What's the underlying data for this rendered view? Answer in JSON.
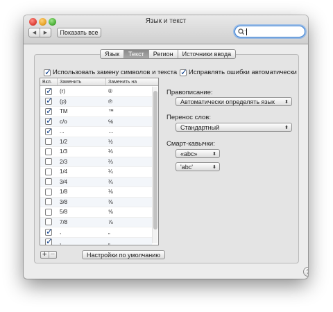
{
  "window": {
    "title": "Язык и текст"
  },
  "toolbar": {
    "back_glyph": "◀",
    "forward_glyph": "▶",
    "show_all_label": "Показать все",
    "search_value": ""
  },
  "tabs": [
    {
      "label": "Язык",
      "active": false
    },
    {
      "label": "Текст",
      "active": true
    },
    {
      "label": "Регион",
      "active": false
    },
    {
      "label": "Источники ввода",
      "active": false
    }
  ],
  "text_tab": {
    "use_substitution_label": "Использовать замену символов и текста",
    "use_substitution_checked": true,
    "autocorrect_label": "Исправлять ошибки автоматически",
    "autocorrect_checked": true,
    "table": {
      "headers": {
        "on": "Вкл.",
        "replace": "Заменить",
        "with": "Заменить на"
      },
      "rows": [
        {
          "on": true,
          "replace": "(r)",
          "with": "®"
        },
        {
          "on": true,
          "replace": "(p)",
          "with": "℗"
        },
        {
          "on": true,
          "replace": "TM",
          "with": "™"
        },
        {
          "on": true,
          "replace": "c/o",
          "with": "℅"
        },
        {
          "on": true,
          "replace": "...",
          "with": "…"
        },
        {
          "on": false,
          "replace": "1/2",
          "with": "½"
        },
        {
          "on": false,
          "replace": "1/3",
          "with": "⅓"
        },
        {
          "on": false,
          "replace": "2/3",
          "with": "⅔"
        },
        {
          "on": false,
          "replace": "1/4",
          "with": "¼"
        },
        {
          "on": false,
          "replace": "3/4",
          "with": "¾"
        },
        {
          "on": false,
          "replace": "1/8",
          "with": "⅛"
        },
        {
          "on": false,
          "replace": "3/8",
          "with": "⅜"
        },
        {
          "on": false,
          "replace": "5/8",
          "with": "⅝"
        },
        {
          "on": false,
          "replace": "7/8",
          "with": "⅞"
        },
        {
          "on": true,
          "replace": ",",
          "with": "„"
        },
        {
          "on": true,
          "replace": ",",
          "with": "„"
        }
      ]
    },
    "add_glyph": "+",
    "remove_glyph": "−",
    "defaults_button": "Настройки по умолчанию",
    "spelling_label": "Правописание:",
    "spelling_value": "Автоматически определять язык",
    "hyphenation_label": "Перенос слов:",
    "hyphenation_value": "Стандартный",
    "smart_quotes_label": "Смарт-кавычки:",
    "double_quotes_value": "«abc»",
    "single_quotes_value": "'abc'",
    "help_glyph": "?"
  }
}
